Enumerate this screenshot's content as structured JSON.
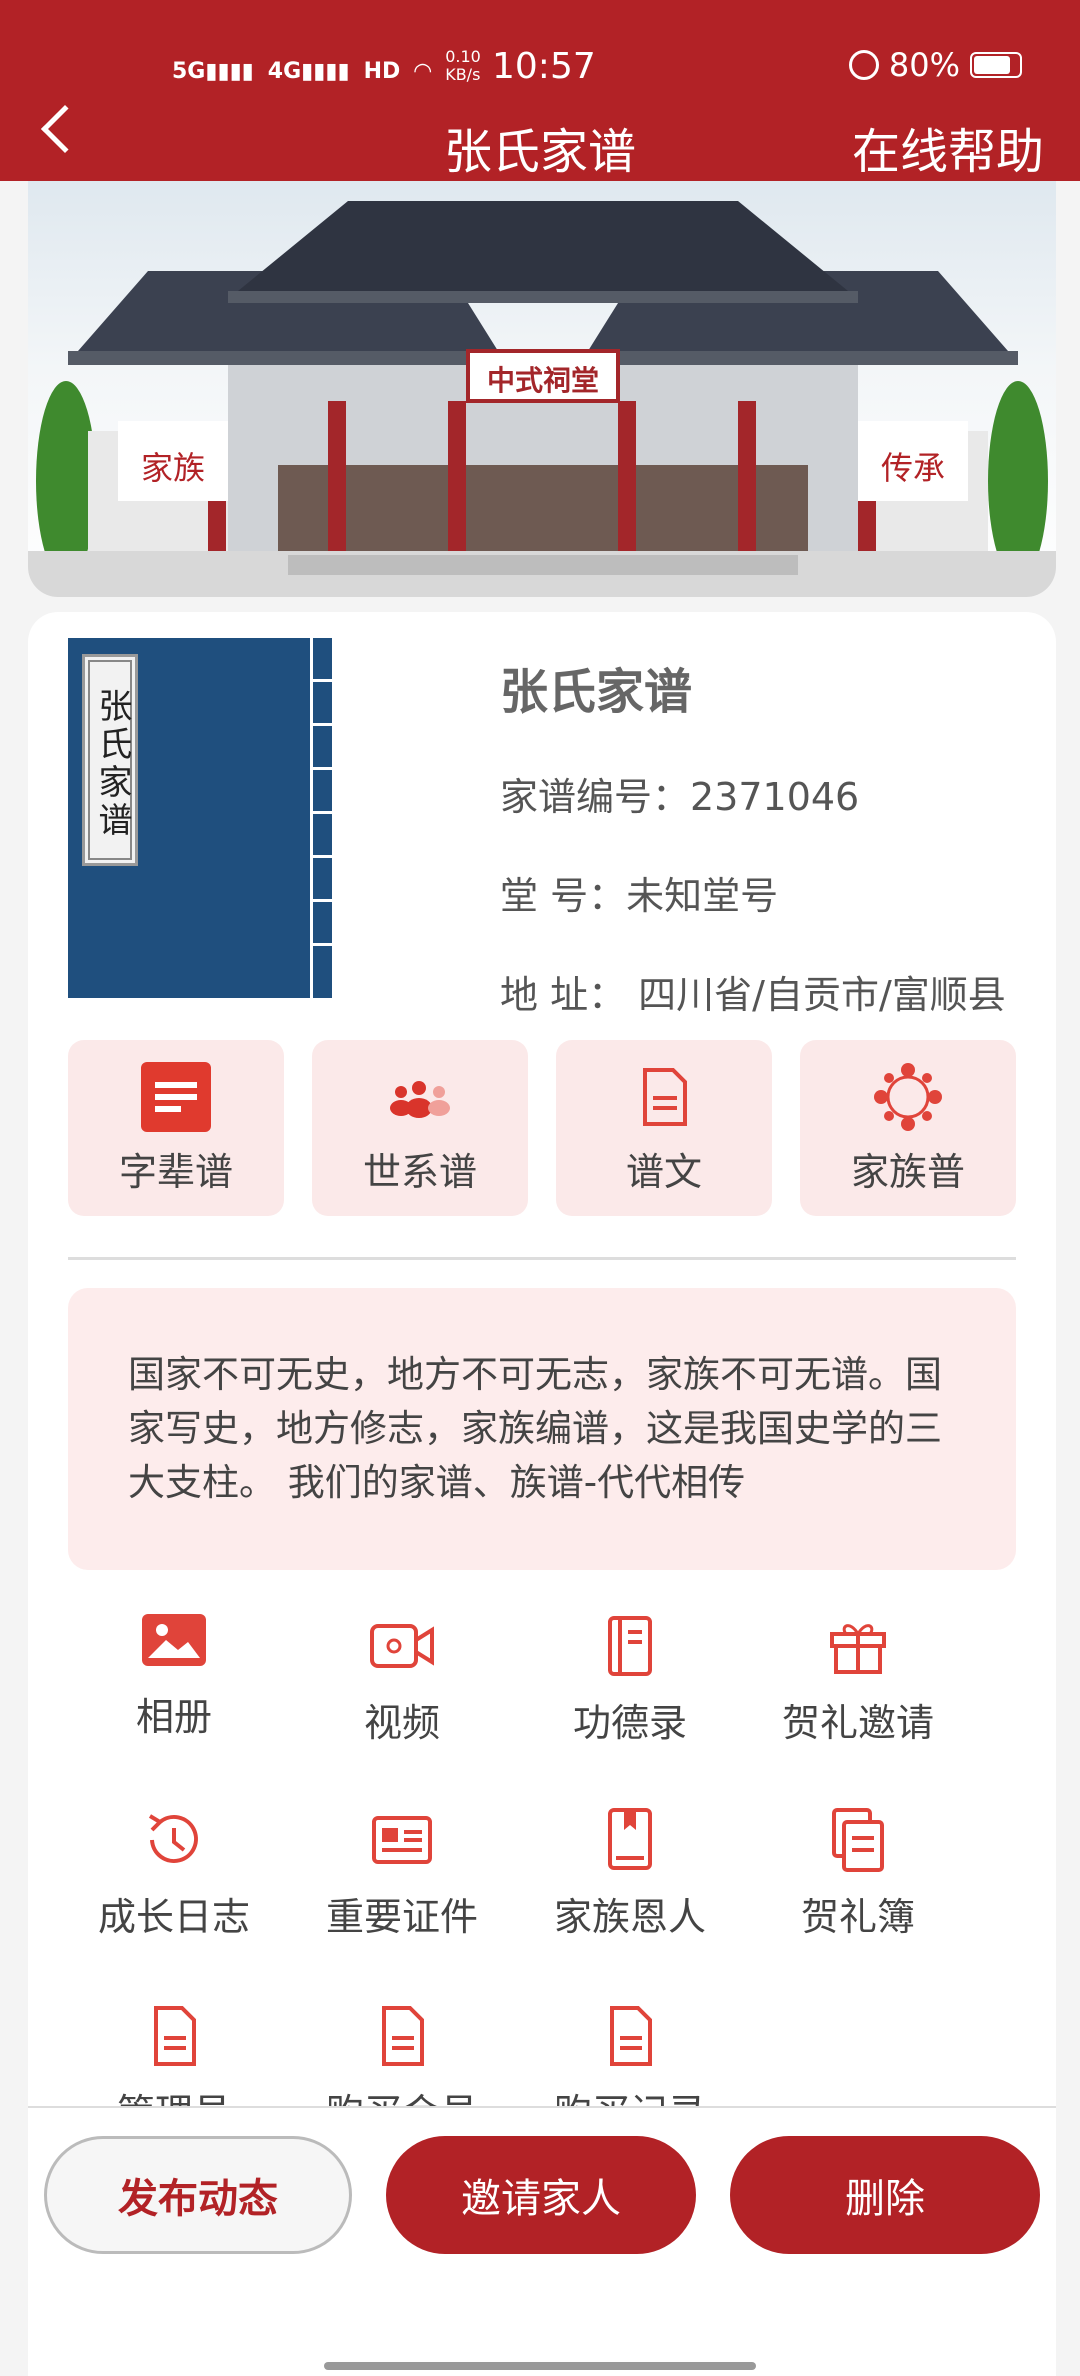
{
  "status_bar": {
    "network": "5G 4G HD",
    "speed": "0.10 KB/s",
    "time": "10:57",
    "battery": "80%"
  },
  "header": {
    "title": "张氏家谱",
    "help": "在线帮助"
  },
  "banner": {
    "plaque": "中式祠堂",
    "left_sign": "家族",
    "right_sign": "传承"
  },
  "book": {
    "cover_title": "张氏家谱"
  },
  "info": {
    "name": "张氏家谱",
    "number": "家谱编号：2371046",
    "hall": "堂 号：未知堂号",
    "address": "地 址：  四川省/自贡市/富顺县"
  },
  "tiles": [
    {
      "label": "字辈谱",
      "icon": "list-icon"
    },
    {
      "label": "世系谱",
      "icon": "people-icon"
    },
    {
      "label": "谱文",
      "icon": "document-icon"
    },
    {
      "label": "家族普",
      "icon": "clan-icon"
    }
  ],
  "intro": {
    "text": "国家不可无史，地方不可无志，家族不可无谱。国家写史，地方修志，家族编谱，这是我国史学的三大支柱。 我们的家谱、族谱-代代相传"
  },
  "grid": [
    {
      "label": "相册",
      "icon": "photo-icon"
    },
    {
      "label": "视频",
      "icon": "video-icon"
    },
    {
      "label": "功德录",
      "icon": "book-icon"
    },
    {
      "label": "贺礼邀请",
      "icon": "gift-icon"
    },
    {
      "label": "成长日志",
      "icon": "history-icon"
    },
    {
      "label": "重要证件",
      "icon": "id-card-icon"
    },
    {
      "label": "家族恩人",
      "icon": "bookmark-icon"
    },
    {
      "label": "贺礼簿",
      "icon": "copy-icon"
    },
    {
      "label": "管理员",
      "icon": "document-icon"
    },
    {
      "label": "购买会员",
      "icon": "document-icon"
    },
    {
      "label": "购买记录",
      "icon": "document-icon"
    }
  ],
  "actions": {
    "post": "发布动态",
    "invite": "邀请家人",
    "delete": "删除"
  },
  "colors": {
    "brand": "#b22226",
    "tile_bg": "#fbe9e9",
    "book_cover": "#1f4f7e"
  }
}
